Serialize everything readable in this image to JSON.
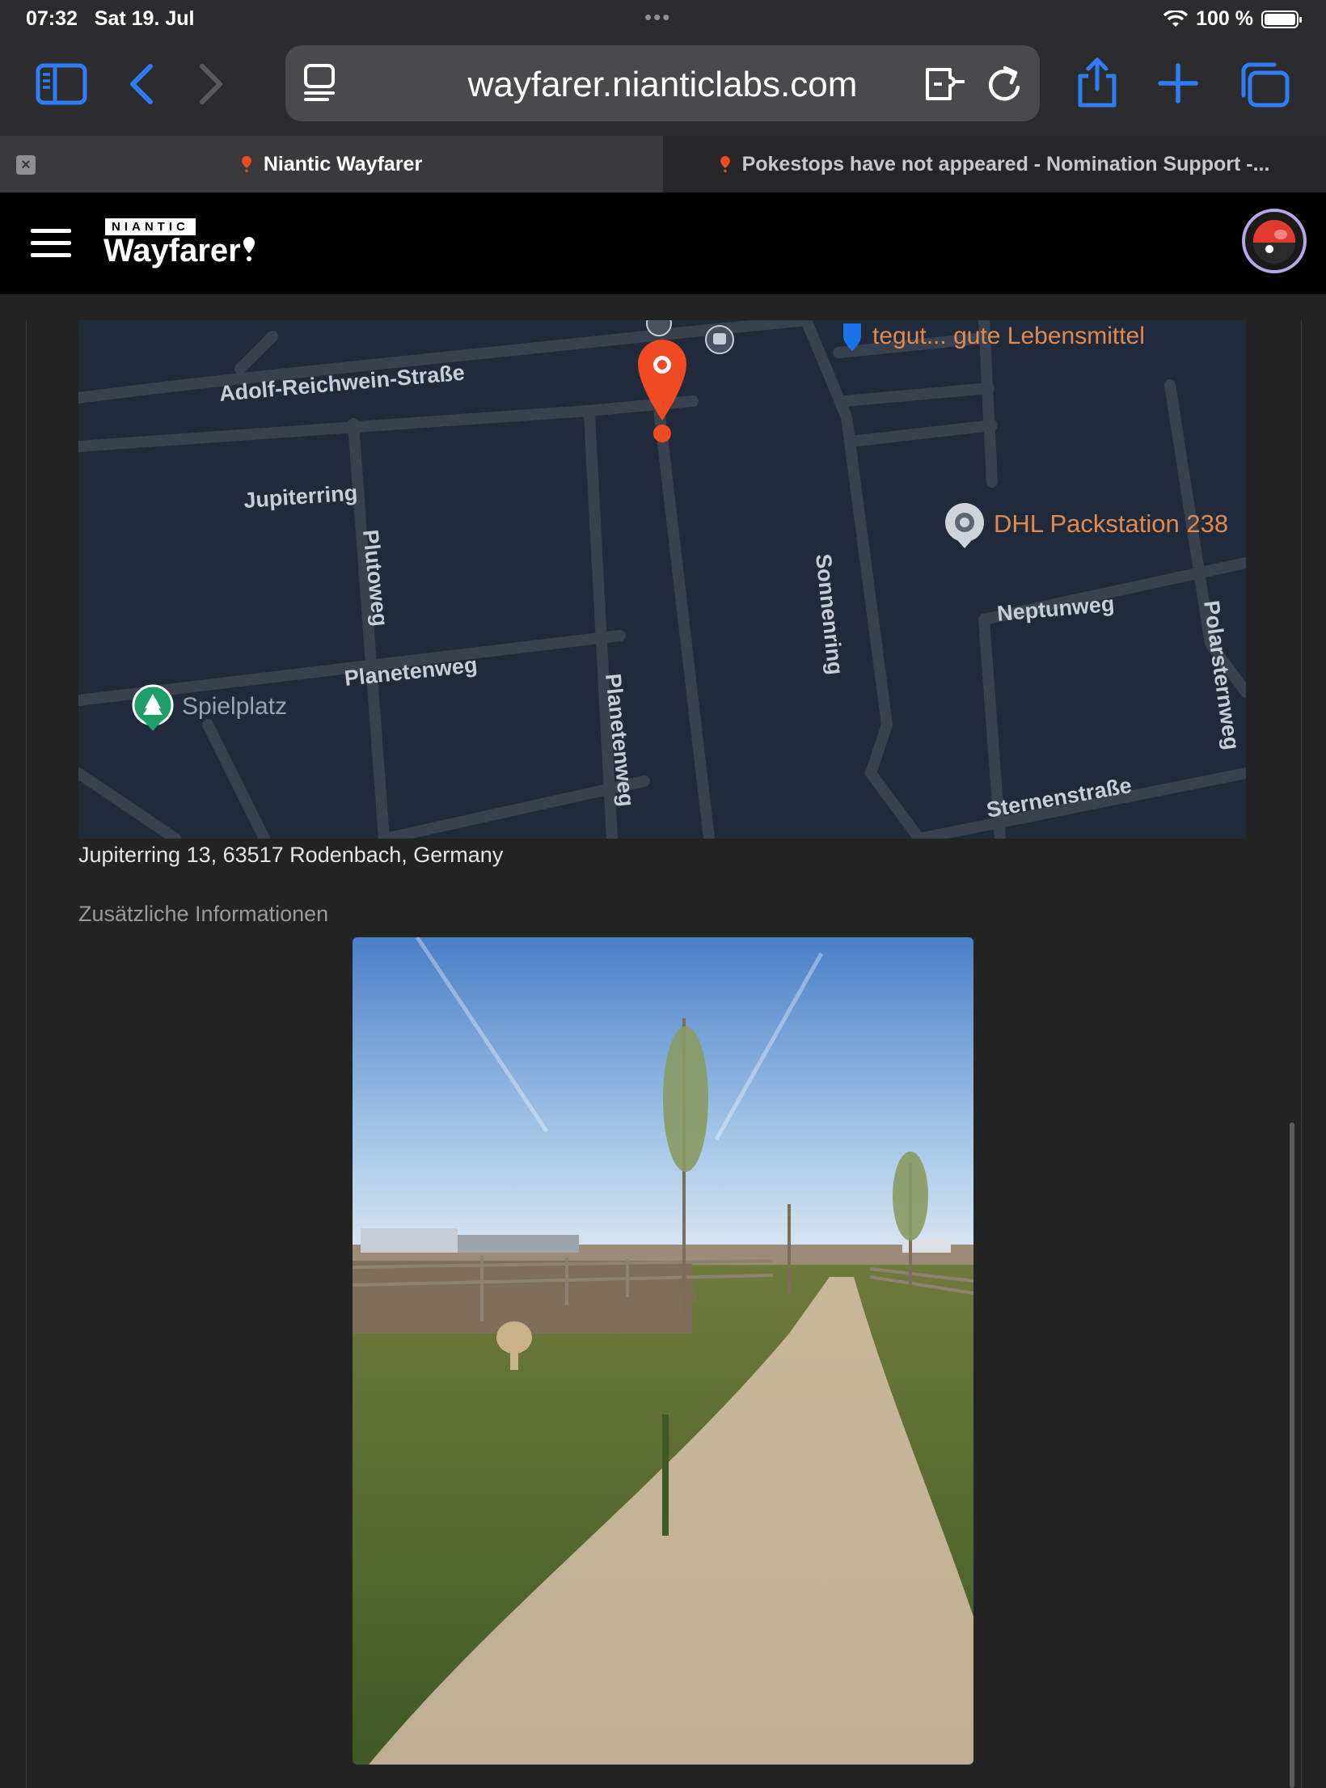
{
  "status_bar": {
    "time": "07:32",
    "date": "Sat 19. Jul",
    "battery": "100 %"
  },
  "toolbar": {
    "url": "wayfarer.nianticlabs.com",
    "icons": [
      "sidebar-icon",
      "back-icon",
      "forward-icon",
      "reader-icon",
      "extension-icon",
      "reload-icon",
      "share-icon",
      "new-tab-icon",
      "tabs-icon"
    ]
  },
  "tabs": [
    {
      "title": "Niantic Wayfarer",
      "active": true
    },
    {
      "title": "Pokestops have not appeared - Nomination Support -...",
      "active": false
    }
  ],
  "header": {
    "brand_small": "NIANTIC",
    "brand": "Wayfarer"
  },
  "map": {
    "labels": {
      "adolf": "Adolf-Reichwein-Straße",
      "jupiterring": "Jupiterring",
      "plutoweg": "Plutoweg",
      "planetenweg_h": "Planetenweg",
      "planetenweg_v": "Planetenweg",
      "sonnenring": "Sonnenring",
      "neptunweg": "Neptunweg",
      "polarsternweg": "Polarsternweg",
      "sternenstrasse": "Sternenstraße",
      "tegut": "tegut... gute Lebensmittel",
      "dhl": "DHL Packstation 238",
      "spielplatz": "Spielplatz"
    }
  },
  "address": "Jupiterring 13, 63517 Rodenbach, Germany",
  "additional_info_label": "Zusätzliche Informationen",
  "colors": {
    "accent": "#2f7df6",
    "pin": "#f04a23",
    "map_bg": "#212a3a",
    "map_road": "#39404e",
    "poi_text": "#e08a4f"
  }
}
